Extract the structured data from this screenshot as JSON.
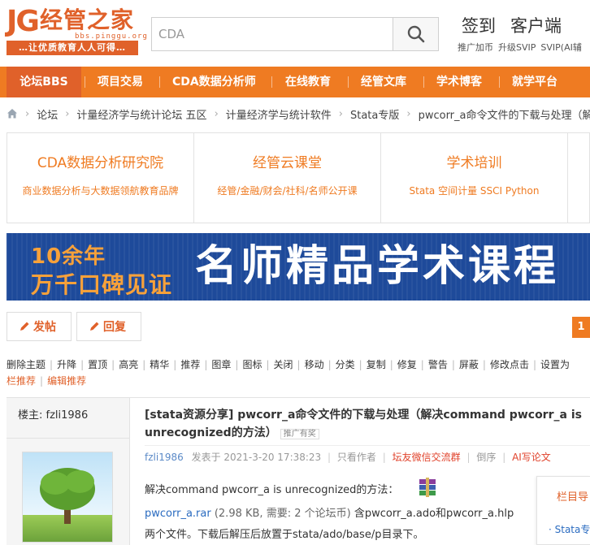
{
  "header": {
    "logo_mark": "JG",
    "logo_name": "经管之家",
    "logo_url": "bbs.pinggu.org",
    "logo_slogan": "…让优质教育人人可得…",
    "search_placeholder": "CDA",
    "links": [
      "签到",
      "客户端"
    ],
    "sub_links": [
      "推广加币",
      "升级SVIP",
      "SVIP(AI辅"
    ]
  },
  "nav": {
    "items": [
      "论坛BBS",
      "项目交易",
      "CDA数据分析师",
      "在线教育",
      "经管文库",
      "学术博客",
      "就学平台"
    ]
  },
  "breadcrumb": {
    "items": [
      "论坛",
      "计量经济学与统计论坛 五区",
      "计量经济学与统计软件",
      "Stata专版",
      "pwcorr_a命令文件的下载与处理（解决"
    ]
  },
  "promos": [
    {
      "title": "CDA数据分析研究院",
      "sub": "商业数据分析与大数据领航教育品牌"
    },
    {
      "title": "经管云课堂",
      "sub": "经管/金融/财会/社科/名师公开课"
    },
    {
      "title": "学术培训",
      "sub": "Stata 空间计量 SSCI Python"
    }
  ],
  "banner": {
    "line1": "10余年",
    "line2": "万千口碑见证",
    "headline": "名师精品学术课程"
  },
  "actions": {
    "post_label": "发帖",
    "reply_label": "回复",
    "page_number": "1"
  },
  "mod_tools": [
    "删除主题",
    "升降",
    "置顶",
    "高亮",
    "精华",
    "推荐",
    "图章",
    "图标",
    "关闭",
    "移动",
    "分类",
    "复制",
    "修复",
    "警告",
    "屏蔽",
    "修改点击",
    "设置为"
  ],
  "mod_tools2": [
    "栏推荐",
    "编辑推荐"
  ],
  "post": {
    "author_label": "楼主: fzli1986",
    "title": "[stata资源分享] pwcorr_a命令文件的下载与处理（解决command pwcorr_a is unrecognized的方法）",
    "title_tag": "推广有奖",
    "meta_author": "fzli1986",
    "meta_time": "发表于 2021-3-20 17:38:23",
    "meta_only_author": "只看作者",
    "meta_wechat": "坛友微信交流群",
    "meta_order": "倒序",
    "meta_ai": "AI写论文",
    "body_line1": "解决command pwcorr_a is unrecognized的方法：",
    "attach_name": "pwcorr_a.rar",
    "attach_info": "(2.98 KB, 需要: 2 个论坛币)",
    "attach_desc": "含pwcorr_a.ado和pwcorr_a.hlp",
    "body_line3": "两个文件。下载后解压后放置于stata/ado/base/p目录下。"
  },
  "side": {
    "title": "栏目导",
    "item": "· Stata专"
  }
}
